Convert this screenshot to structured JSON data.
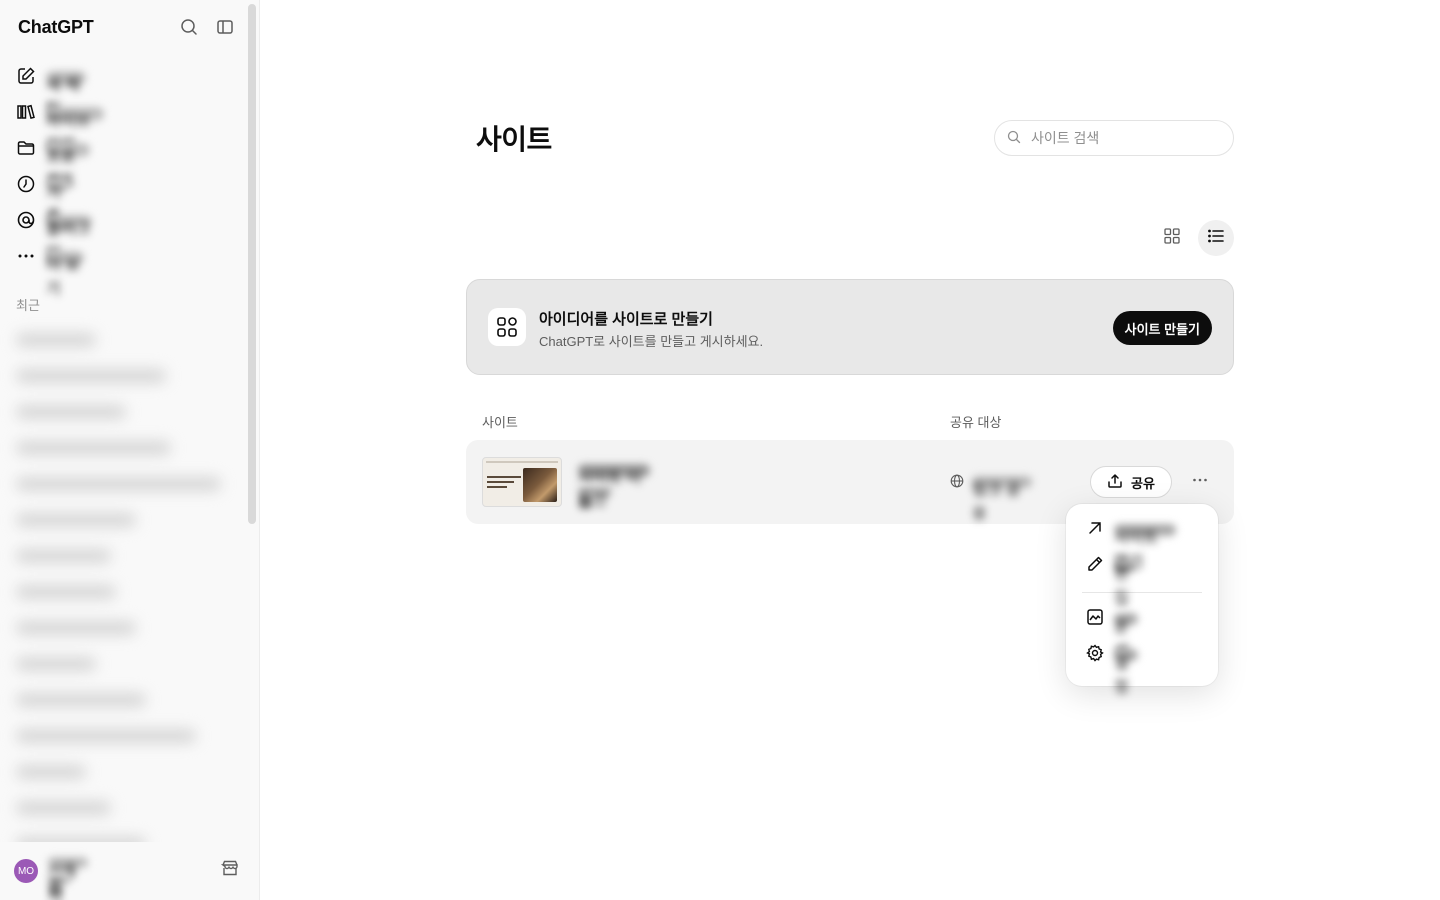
{
  "sidebar": {
    "brand": "ChatGPT",
    "nav": [
      {
        "icon": "compose-icon",
        "label": "새 채팅"
      },
      {
        "icon": "library-icon",
        "label": "라이브러리"
      },
      {
        "icon": "folder-icon",
        "label": "프로젝트"
      },
      {
        "icon": "history-icon",
        "label": "기록"
      },
      {
        "icon": "sora-icon",
        "label": "플러그인"
      },
      {
        "icon": "more-dots-icon",
        "label": "더 보기"
      }
    ],
    "recent_header": "최근",
    "user": {
      "initials": "MO",
      "name": "사용자",
      "plan": "플랜"
    }
  },
  "main": {
    "title": "사이트",
    "search_placeholder": "사이트 검색",
    "banner": {
      "title": "아이디어를 사이트로 만들기",
      "subtitle": "ChatGPT로 사이트를 만들고 게시하세요.",
      "button": "사이트 만들기"
    },
    "columns": {
      "site": "사이트",
      "share": "공유 대상"
    },
    "rows": [
      {
        "name": "사이트 이름",
        "sub": "초안",
        "share_target": "링크 공유",
        "share_button": "공유"
      }
    ],
    "menu": [
      {
        "icon": "open-external-icon",
        "label": "사이트 열기"
      },
      {
        "icon": "pencil-icon",
        "label": "편집"
      },
      {
        "icon": "image-icon",
        "label": "분석"
      },
      {
        "icon": "gear-icon",
        "label": "설정"
      }
    ]
  }
}
